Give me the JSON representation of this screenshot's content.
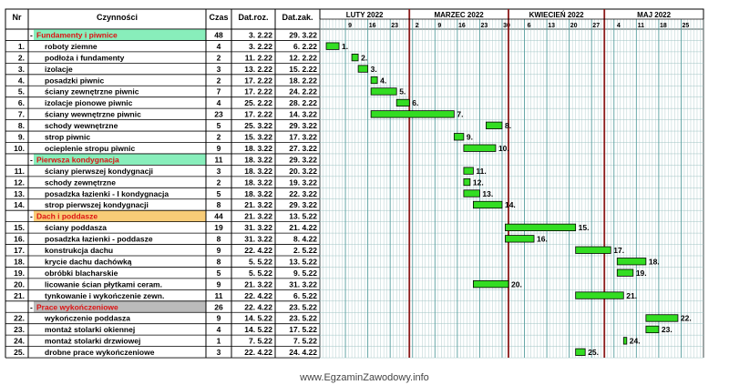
{
  "headers": {
    "nr": "Nr",
    "task": "Czynności",
    "duration": "Czas",
    "start": "Dat.roz.",
    "end": "Dat.zak."
  },
  "months": [
    {
      "label": "LUTY 2022",
      "ticks": [
        "9",
        "16",
        "23"
      ]
    },
    {
      "label": "MARZEC 2022",
      "ticks": [
        "2",
        "9",
        "16",
        "23",
        "30"
      ]
    },
    {
      "label": "KWIECIEŃ 2022",
      "ticks": [
        "6",
        "13",
        "20",
        "27"
      ]
    },
    {
      "label": "MAJ 2022",
      "ticks": [
        "4",
        "11",
        "18",
        "25"
      ]
    }
  ],
  "colors": {
    "bar": "#33dd22",
    "bar_border": "#000000",
    "month_line": "#8b1a1a",
    "grid": "#9fc3c3",
    "group_name": "#dd1111",
    "group_bg": [
      "#88eebb",
      "#88eebb",
      "#f8cc77",
      "#bbbbbb"
    ]
  },
  "rows": [
    {
      "kind": "group",
      "nr": "-",
      "name": "Fundamenty i piwnice",
      "duration": "48",
      "start": "3. 2.22",
      "end": "29. 3.22"
    },
    {
      "kind": "task",
      "nr": "1.",
      "name": "roboty ziemne",
      "duration": "4",
      "start": "3. 2.22",
      "end": "6. 2.22",
      "label": "1."
    },
    {
      "kind": "task",
      "nr": "2.",
      "name": "podłoża i fundamenty",
      "duration": "2",
      "start": "11. 2.22",
      "end": "12. 2.22",
      "label": "2."
    },
    {
      "kind": "task",
      "nr": "3.",
      "name": "izolacje",
      "duration": "3",
      "start": "13. 2.22",
      "end": "15. 2.22",
      "label": "3."
    },
    {
      "kind": "task",
      "nr": "4.",
      "name": "posadzki piwnic",
      "duration": "2",
      "start": "17. 2.22",
      "end": "18. 2.22",
      "label": "4."
    },
    {
      "kind": "task",
      "nr": "5.",
      "name": "ściany zewnętrzne piwnic",
      "duration": "7",
      "start": "17. 2.22",
      "end": "24. 2.22",
      "label": "5."
    },
    {
      "kind": "task",
      "nr": "6.",
      "name": "izolacje pionowe piwnic",
      "duration": "4",
      "start": "25. 2.22",
      "end": "28. 2.22",
      "label": "6."
    },
    {
      "kind": "task",
      "nr": "7.",
      "name": "ściany wewnętrzne piwnic",
      "duration": "23",
      "start": "17. 2.22",
      "end": "14. 3.22",
      "label": "7."
    },
    {
      "kind": "task",
      "nr": "8.",
      "name": "schody wewnętrzne",
      "duration": "5",
      "start": "25. 3.22",
      "end": "29. 3.22",
      "label": "8."
    },
    {
      "kind": "task",
      "nr": "9.",
      "name": "strop piwnic",
      "duration": "2",
      "start": "15. 3.22",
      "end": "17. 3.22",
      "label": "9."
    },
    {
      "kind": "task",
      "nr": "10.",
      "name": "ocieplenie stropu piwnic",
      "duration": "9",
      "start": "18. 3.22",
      "end": "27. 3.22",
      "label": "10."
    },
    {
      "kind": "group",
      "nr": "-",
      "name": "Pierwsza kondygnacja",
      "duration": "11",
      "start": "18. 3.22",
      "end": "29. 3.22"
    },
    {
      "kind": "task",
      "nr": "11.",
      "name": "ściany pierwszej kondygnacji",
      "duration": "3",
      "start": "18. 3.22",
      "end": "20. 3.22",
      "label": "11."
    },
    {
      "kind": "task",
      "nr": "12.",
      "name": "schody zewnętrzne",
      "duration": "2",
      "start": "18. 3.22",
      "end": "19. 3.22",
      "label": "12."
    },
    {
      "kind": "task",
      "nr": "13.",
      "name": "posadzka łazienki - I kondygnacja",
      "duration": "5",
      "start": "18. 3.22",
      "end": "22. 3.22",
      "label": "13."
    },
    {
      "kind": "task",
      "nr": "14.",
      "name": "strop pierwszej kondygnacji",
      "duration": "8",
      "start": "21. 3.22",
      "end": "29. 3.22",
      "label": "14."
    },
    {
      "kind": "group",
      "nr": "-",
      "name": "Dach i poddasze",
      "duration": "44",
      "start": "21. 3.22",
      "end": "13. 5.22"
    },
    {
      "kind": "task",
      "nr": "15.",
      "name": "ściany poddasza",
      "duration": "19",
      "start": "31. 3.22",
      "end": "21. 4.22",
      "label": "15."
    },
    {
      "kind": "task",
      "nr": "16.",
      "name": "posadzka łazienki - poddasze",
      "duration": "8",
      "start": "31. 3.22",
      "end": "8. 4.22",
      "label": "16."
    },
    {
      "kind": "task",
      "nr": "17.",
      "name": "konstrukcja dachu",
      "duration": "9",
      "start": "22. 4.22",
      "end": "2. 5.22",
      "label": "17."
    },
    {
      "kind": "task",
      "nr": "18.",
      "name": "krycie dachu dachówką",
      "duration": "8",
      "start": "5. 5.22",
      "end": "13. 5.22",
      "label": "18."
    },
    {
      "kind": "task",
      "nr": "19.",
      "name": "obróbki blacharskie",
      "duration": "5",
      "start": "5. 5.22",
      "end": "9. 5.22",
      "label": "19."
    },
    {
      "kind": "task",
      "nr": "20.",
      "name": "licowanie ścian płytkami ceram.",
      "duration": "9",
      "start": "21. 3.22",
      "end": "31. 3.22",
      "label": "20."
    },
    {
      "kind": "task",
      "nr": "21.",
      "name": "tynkowanie i wykończenie zewn.",
      "duration": "11",
      "start": "22. 4.22",
      "end": "6. 5.22",
      "label": "21."
    },
    {
      "kind": "group",
      "nr": "-",
      "name": "Prace wykończeniowe",
      "duration": "26",
      "start": "22. 4.22",
      "end": "23. 5.22"
    },
    {
      "kind": "task",
      "nr": "22.",
      "name": "wykończenie poddasza",
      "duration": "9",
      "start": "14. 5.22",
      "end": "23. 5.22",
      "label": "22."
    },
    {
      "kind": "task",
      "nr": "23.",
      "name": "montaż stolarki okiennej",
      "duration": "4",
      "start": "14. 5.22",
      "end": "17. 5.22",
      "label": "23."
    },
    {
      "kind": "task",
      "nr": "24.",
      "name": "montaż stolarki drzwiowej",
      "duration": "1",
      "start": "7. 5.22",
      "end": "7. 5.22",
      "label": "24."
    },
    {
      "kind": "task",
      "nr": "25.",
      "name": "drobne prace wykończeniowe",
      "duration": "3",
      "start": "22. 4.22",
      "end": "24. 4.22",
      "label": "25."
    }
  ],
  "chart_data": {
    "type": "gantt",
    "x_range": [
      "2022-02-01",
      "2022-05-31"
    ],
    "tasks": [
      {
        "id": "1.",
        "start": "2022-02-03",
        "end": "2022-02-06"
      },
      {
        "id": "2.",
        "start": "2022-02-11",
        "end": "2022-02-12"
      },
      {
        "id": "3.",
        "start": "2022-02-13",
        "end": "2022-02-15"
      },
      {
        "id": "4.",
        "start": "2022-02-17",
        "end": "2022-02-18"
      },
      {
        "id": "5.",
        "start": "2022-02-17",
        "end": "2022-02-24"
      },
      {
        "id": "6.",
        "start": "2022-02-25",
        "end": "2022-02-28"
      },
      {
        "id": "7.",
        "start": "2022-02-17",
        "end": "2022-03-14"
      },
      {
        "id": "8.",
        "start": "2022-03-25",
        "end": "2022-03-29"
      },
      {
        "id": "9.",
        "start": "2022-03-15",
        "end": "2022-03-17"
      },
      {
        "id": "10.",
        "start": "2022-03-18",
        "end": "2022-03-27"
      },
      {
        "id": "11.",
        "start": "2022-03-18",
        "end": "2022-03-20"
      },
      {
        "id": "12.",
        "start": "2022-03-18",
        "end": "2022-03-19"
      },
      {
        "id": "13.",
        "start": "2022-03-18",
        "end": "2022-03-22"
      },
      {
        "id": "14.",
        "start": "2022-03-21",
        "end": "2022-03-29"
      },
      {
        "id": "15.",
        "start": "2022-03-31",
        "end": "2022-04-21"
      },
      {
        "id": "16.",
        "start": "2022-03-31",
        "end": "2022-04-08"
      },
      {
        "id": "17.",
        "start": "2022-04-22",
        "end": "2022-05-02"
      },
      {
        "id": "18.",
        "start": "2022-05-05",
        "end": "2022-05-13"
      },
      {
        "id": "19.",
        "start": "2022-05-05",
        "end": "2022-05-09"
      },
      {
        "id": "20.",
        "start": "2022-03-21",
        "end": "2022-03-31"
      },
      {
        "id": "21.",
        "start": "2022-04-22",
        "end": "2022-05-06"
      },
      {
        "id": "22.",
        "start": "2022-05-14",
        "end": "2022-05-23"
      },
      {
        "id": "23.",
        "start": "2022-05-14",
        "end": "2022-05-17"
      },
      {
        "id": "24.",
        "start": "2022-05-07",
        "end": "2022-05-07"
      },
      {
        "id": "25.",
        "start": "2022-04-22",
        "end": "2022-04-24"
      }
    ]
  },
  "watermark": "www.EgzaminZawodowy.info"
}
